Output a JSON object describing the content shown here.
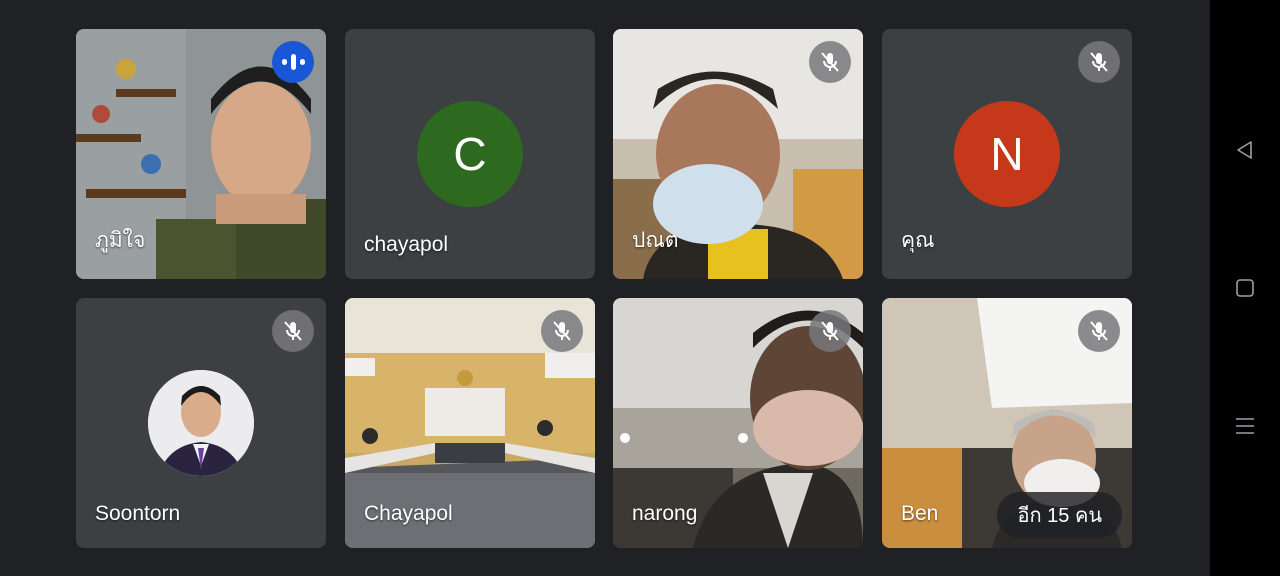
{
  "participants": [
    {
      "name": "ภูมิใจ",
      "status": "speaking"
    },
    {
      "name": "chayapol",
      "avatar_letter": "C",
      "avatar_color": "#2d6a1f",
      "status": "muted"
    },
    {
      "name": "ปณต",
      "status": "muted"
    },
    {
      "name": "คุณ",
      "avatar_letter": "N",
      "avatar_color": "#c5391a",
      "status": "muted"
    },
    {
      "name": "Soontorn",
      "status": "muted"
    },
    {
      "name": "Chayapol",
      "status": "muted"
    },
    {
      "name": "narong",
      "status": "muted"
    },
    {
      "name": "Ben",
      "status": "muted"
    }
  ],
  "more_participants_label": "อีก 15 คน",
  "icons": {
    "speaking": "audio-level-icon",
    "muted": "mic-off-icon",
    "nav_back": "triangle-back-icon",
    "nav_home": "square-home-icon",
    "nav_menu": "hamburger-menu-icon"
  },
  "colors": {
    "background": "#202124",
    "tile": "#3c4043",
    "speaking_badge": "#1a57d6",
    "nav_bar": "#000000"
  }
}
